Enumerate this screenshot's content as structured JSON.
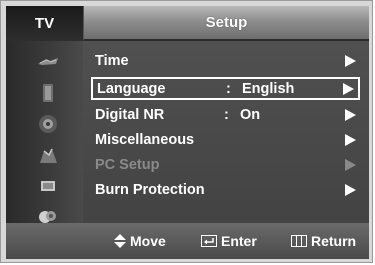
{
  "source_label": "TV",
  "menu_title": "Setup",
  "sidebar": {
    "icons": [
      "picture-icon",
      "sound-icon",
      "channel-icon",
      "setup-icon",
      "input-icon",
      "guide-icon"
    ]
  },
  "menu": {
    "items": [
      {
        "label": "Time",
        "colon": "",
        "value": "",
        "selected": false,
        "disabled": false
      },
      {
        "label": "Language",
        "colon": ":",
        "value": "English",
        "selected": true,
        "disabled": false
      },
      {
        "label": "Digital NR",
        "colon": ":",
        "value": "On",
        "selected": false,
        "disabled": false
      },
      {
        "label": "Miscellaneous",
        "colon": "",
        "value": "",
        "selected": false,
        "disabled": false
      },
      {
        "label": "PC Setup",
        "colon": "",
        "value": "",
        "selected": false,
        "disabled": true
      },
      {
        "label": "Burn Protection",
        "colon": "",
        "value": "",
        "selected": false,
        "disabled": false
      }
    ]
  },
  "footer": {
    "move": "Move",
    "enter": "Enter",
    "return": "Return"
  },
  "colors": {
    "text": "#ffffff",
    "disabled_text": "#8a8a8a",
    "background": "#434343"
  }
}
